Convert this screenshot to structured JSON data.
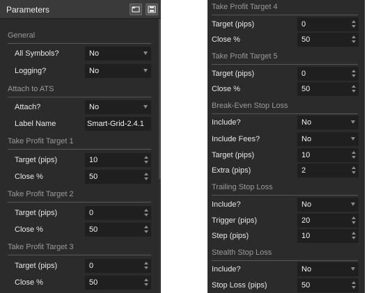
{
  "left_panel": {
    "title": "Parameters",
    "sections": {
      "general": "General",
      "attach": "Attach to ATS",
      "tp1": "Take Profit Target 1",
      "tp2": "Take Profit Target 2",
      "tp3": "Take Profit Target 3"
    },
    "fields": {
      "all_symbols": {
        "label": "All Symbols?",
        "value": "No"
      },
      "logging": {
        "label": "Logging?",
        "value": "No"
      },
      "attach": {
        "label": "Attach?",
        "value": "No"
      },
      "label_name": {
        "label": "Label Name",
        "value": "Smart-Grid-2.4.1"
      },
      "tp1_target": {
        "label": "Target (pips)",
        "value": "10"
      },
      "tp1_close": {
        "label": "Close %",
        "value": "50"
      },
      "tp2_target": {
        "label": "Target (pips)",
        "value": "0"
      },
      "tp2_close": {
        "label": "Close %",
        "value": "50"
      },
      "tp3_target": {
        "label": "Target (pips)",
        "value": "0"
      },
      "tp3_close": {
        "label": "Close %",
        "value": "50"
      }
    }
  },
  "right_panel": {
    "sections": {
      "tp4": "Take Profit Target 4",
      "tp5": "Take Profit Target 5",
      "breakeven": "Break-Even Stop Loss",
      "trailing": "Trailing Stop Loss",
      "stealth": "Stealth Stop Loss"
    },
    "fields": {
      "tp4_target": {
        "label": "Target (pips)",
        "value": "0"
      },
      "tp4_close": {
        "label": "Close %",
        "value": "50"
      },
      "tp5_target": {
        "label": "Target (pips)",
        "value": "0"
      },
      "tp5_close": {
        "label": "Close %",
        "value": "50"
      },
      "be_include": {
        "label": "Include?",
        "value": "No"
      },
      "be_include_fees": {
        "label": "Include Fees?",
        "value": "No"
      },
      "be_target": {
        "label": "Target (pips)",
        "value": "10"
      },
      "be_extra": {
        "label": "Extra (pips)",
        "value": "2"
      },
      "ts_include": {
        "label": "Include?",
        "value": "No"
      },
      "ts_trigger": {
        "label": "Trigger (pips)",
        "value": "20"
      },
      "ts_step": {
        "label": "Step (pips)",
        "value": "10"
      },
      "ss_include": {
        "label": "Include?",
        "value": "No"
      },
      "ss_stop_loss": {
        "label": "Stop Loss (pips)",
        "value": "50"
      }
    }
  },
  "icons": {
    "open": "folder-open-icon",
    "save": "save-icon"
  },
  "colors": {
    "panel_bg": "#2b2b2b",
    "field_bg": "#1f1f1f",
    "section_text": "#9a9a9a",
    "label_text": "#e8e8e8"
  }
}
